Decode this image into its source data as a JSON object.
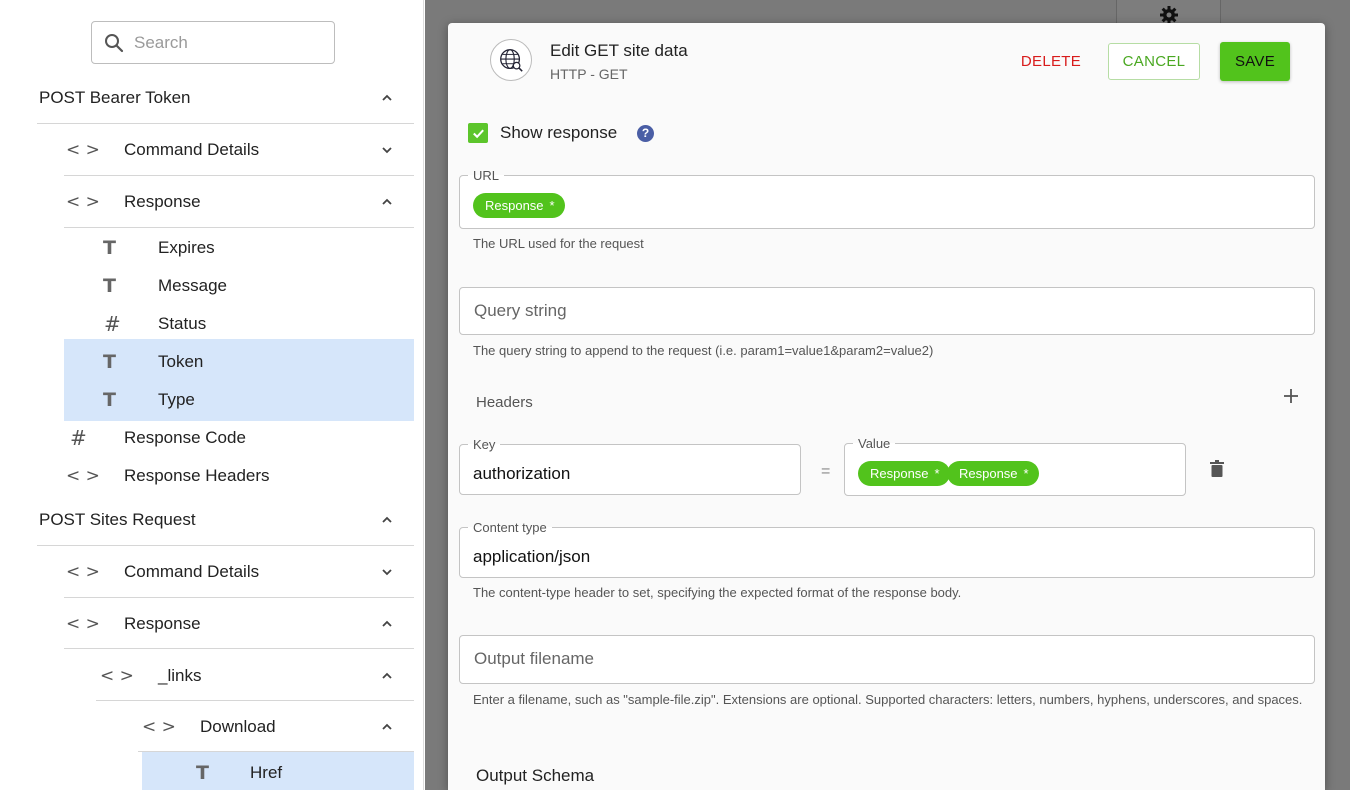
{
  "sidebar": {
    "search_placeholder": "Search",
    "items": [
      {
        "label": "POST Bearer Token",
        "icon": "",
        "expanded": true
      },
      {
        "label": "Command Details",
        "icon": "< >",
        "expanded": false
      },
      {
        "label": "Response",
        "icon": "< >",
        "expanded": true
      },
      {
        "label": "Expires",
        "icon": "T"
      },
      {
        "label": "Message",
        "icon": "T"
      },
      {
        "label": "Status",
        "icon": "#"
      },
      {
        "label": "Token",
        "icon": "T",
        "selected": true
      },
      {
        "label": "Type",
        "icon": "T",
        "selected": true
      },
      {
        "label": "Response Code",
        "icon": "#"
      },
      {
        "label": "Response Headers",
        "icon": "< >"
      },
      {
        "label": "POST Sites Request",
        "icon": "",
        "expanded": true
      },
      {
        "label": "Command Details",
        "icon": "< >",
        "expanded": false
      },
      {
        "label": "Response",
        "icon": "< >",
        "expanded": true
      },
      {
        "label": "_links",
        "icon": "< >",
        "expanded": true
      },
      {
        "label": "Download",
        "icon": "< >",
        "expanded": true
      },
      {
        "label": "Href",
        "icon": "T",
        "selected": true
      }
    ]
  },
  "dialog": {
    "title": "Edit GET site data",
    "subtitle": "HTTP - GET",
    "delete_label": "DELETE",
    "cancel_label": "CANCEL",
    "save_label": "SAVE",
    "show_response_label": "Show response",
    "show_response_checked": true,
    "help_glyph": "?",
    "url": {
      "label": "URL",
      "chips": [
        "Response"
      ],
      "helper": "The URL used for the request"
    },
    "query": {
      "placeholder": "Query string",
      "helper": "The query string to append to the request (i.e. param1=value1&param2=value2)"
    },
    "headers": {
      "label": "Headers",
      "key_label": "Key",
      "key_value": "authorization",
      "equals": "=",
      "value_label": "Value",
      "value_chips": [
        "Response",
        "Response"
      ]
    },
    "content_type": {
      "label": "Content type",
      "value": "application/json",
      "helper": "The content-type header to set, specifying the expected format of the response body."
    },
    "output_filename": {
      "placeholder": "Output filename",
      "helper": "Enter a filename, such as \"sample-file.zip\". Extensions are optional. Supported characters: letters, numbers, hyphens, underscores, and spaces."
    },
    "output_schema_label": "Output Schema",
    "chip_marker": "*"
  },
  "colors": {
    "accent_green": "#52c31c",
    "delete_red": "#d81b1b",
    "selection_blue": "#d6e6fa",
    "help_blue": "#4a5ea5",
    "backdrop": "#7a7a7a"
  }
}
